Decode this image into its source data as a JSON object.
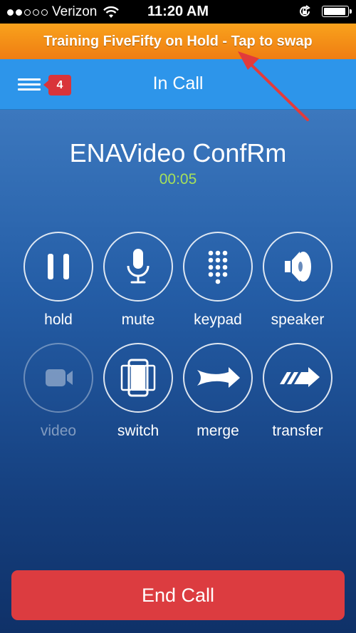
{
  "status_bar": {
    "carrier": "Verizon",
    "time": "11:20 AM",
    "signal_bars_filled": 2,
    "signal_bars_total": 5,
    "battery_level": 0.9
  },
  "hold_banner": {
    "text": "Training FiveFifty on Hold - Tap to swap"
  },
  "nav": {
    "title": "In Call",
    "badge_count": "4"
  },
  "call": {
    "contact_name": "ENAVideo ConfRm",
    "timer": "00:05"
  },
  "controls": {
    "hold": "hold",
    "mute": "mute",
    "keypad": "keypad",
    "speaker": "speaker",
    "video": "video",
    "switch": "switch",
    "merge": "merge",
    "transfer": "transfer"
  },
  "end_call_label": "End Call",
  "colors": {
    "hold_banner": "#f39019",
    "nav_bar": "#2d95ea",
    "end_call": "#dc3c40",
    "timer": "#a6e05a"
  }
}
